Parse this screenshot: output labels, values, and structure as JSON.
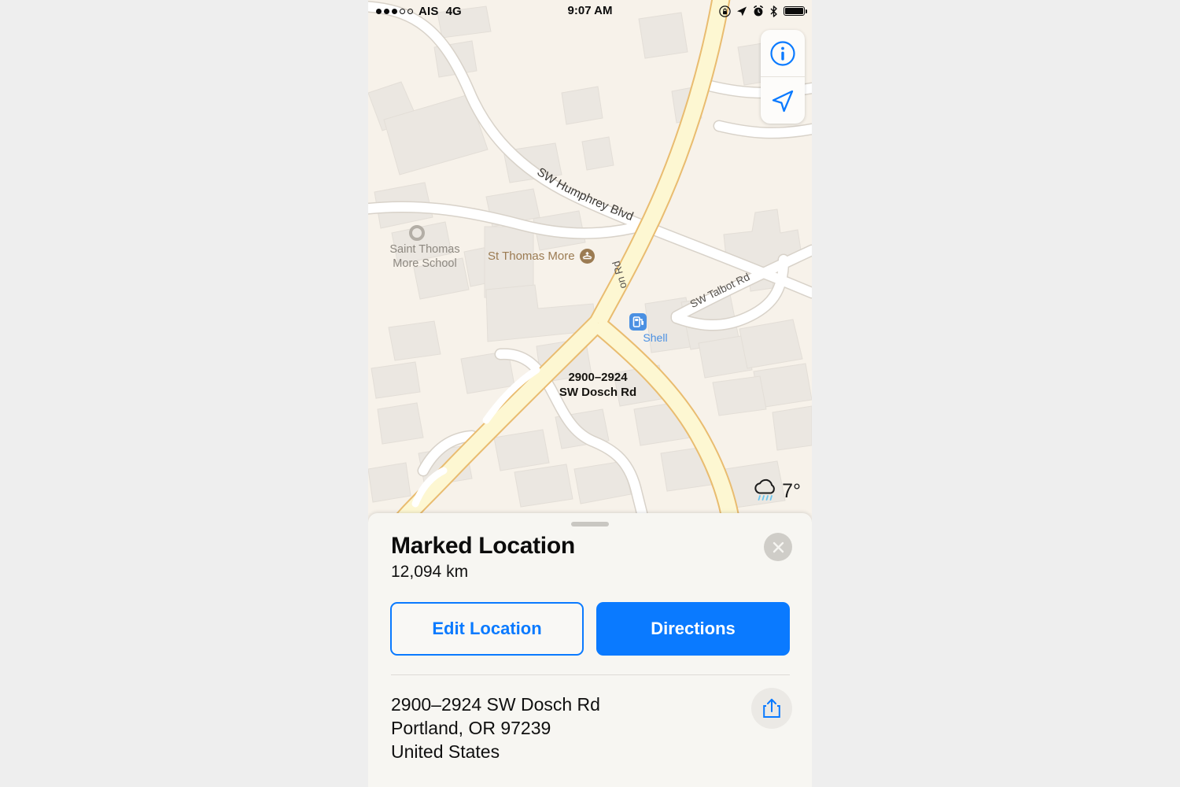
{
  "status_bar": {
    "signal_filled_dots": 3,
    "signal_empty_dots": 2,
    "carrier": "AIS",
    "network": "4G",
    "time": "9:07 AM",
    "icons": [
      "rotation-lock-icon",
      "location-arrow-icon",
      "alarm-clock-icon",
      "bluetooth-icon",
      "battery-icon"
    ]
  },
  "map": {
    "controls": {
      "info_label": "i",
      "info_icon": "info-circle-icon",
      "locate_icon": "location-arrow-icon"
    },
    "weather": {
      "icon": "rain-cloud-icon",
      "temperature": "7°"
    },
    "pin": {
      "icon": "map-pin-icon",
      "color": "#f7503c"
    },
    "labels": [
      {
        "text": "SW Humphrey Blvd",
        "type": "road"
      },
      {
        "text": "SW Talbot Rd",
        "type": "road"
      },
      {
        "text": "on Rd",
        "type": "road"
      },
      {
        "text": "Saint Thomas",
        "type": "place"
      },
      {
        "text": "More School",
        "type": "place"
      },
      {
        "text": "St Thomas More",
        "type": "poi"
      },
      {
        "text": "Shell",
        "type": "poi-fuel"
      },
      {
        "text": "2900–2924",
        "type": "address"
      },
      {
        "text": "SW Dosch Rd",
        "type": "address"
      }
    ],
    "colors": {
      "background": "#f7f2ea",
      "road_minor": "#ffffff",
      "road_major": "#fcf5cf",
      "road_major_border": "#e8b96a",
      "building": "#ebe7e1",
      "poi_brown": "#9b7b52",
      "poi_blue": "#4a90e2"
    }
  },
  "sheet": {
    "title": "Marked Location",
    "subtitle": "12,094 km",
    "close_icon": "close-icon",
    "grabber": "drag-handle",
    "buttons": {
      "edit_location": "Edit Location",
      "directions": "Directions"
    },
    "address_lines": [
      "2900–2924 SW Dosch Rd",
      "Portland, OR  97239",
      "United States"
    ],
    "share_icon": "share-icon",
    "accent_color": "#0a7aff"
  }
}
